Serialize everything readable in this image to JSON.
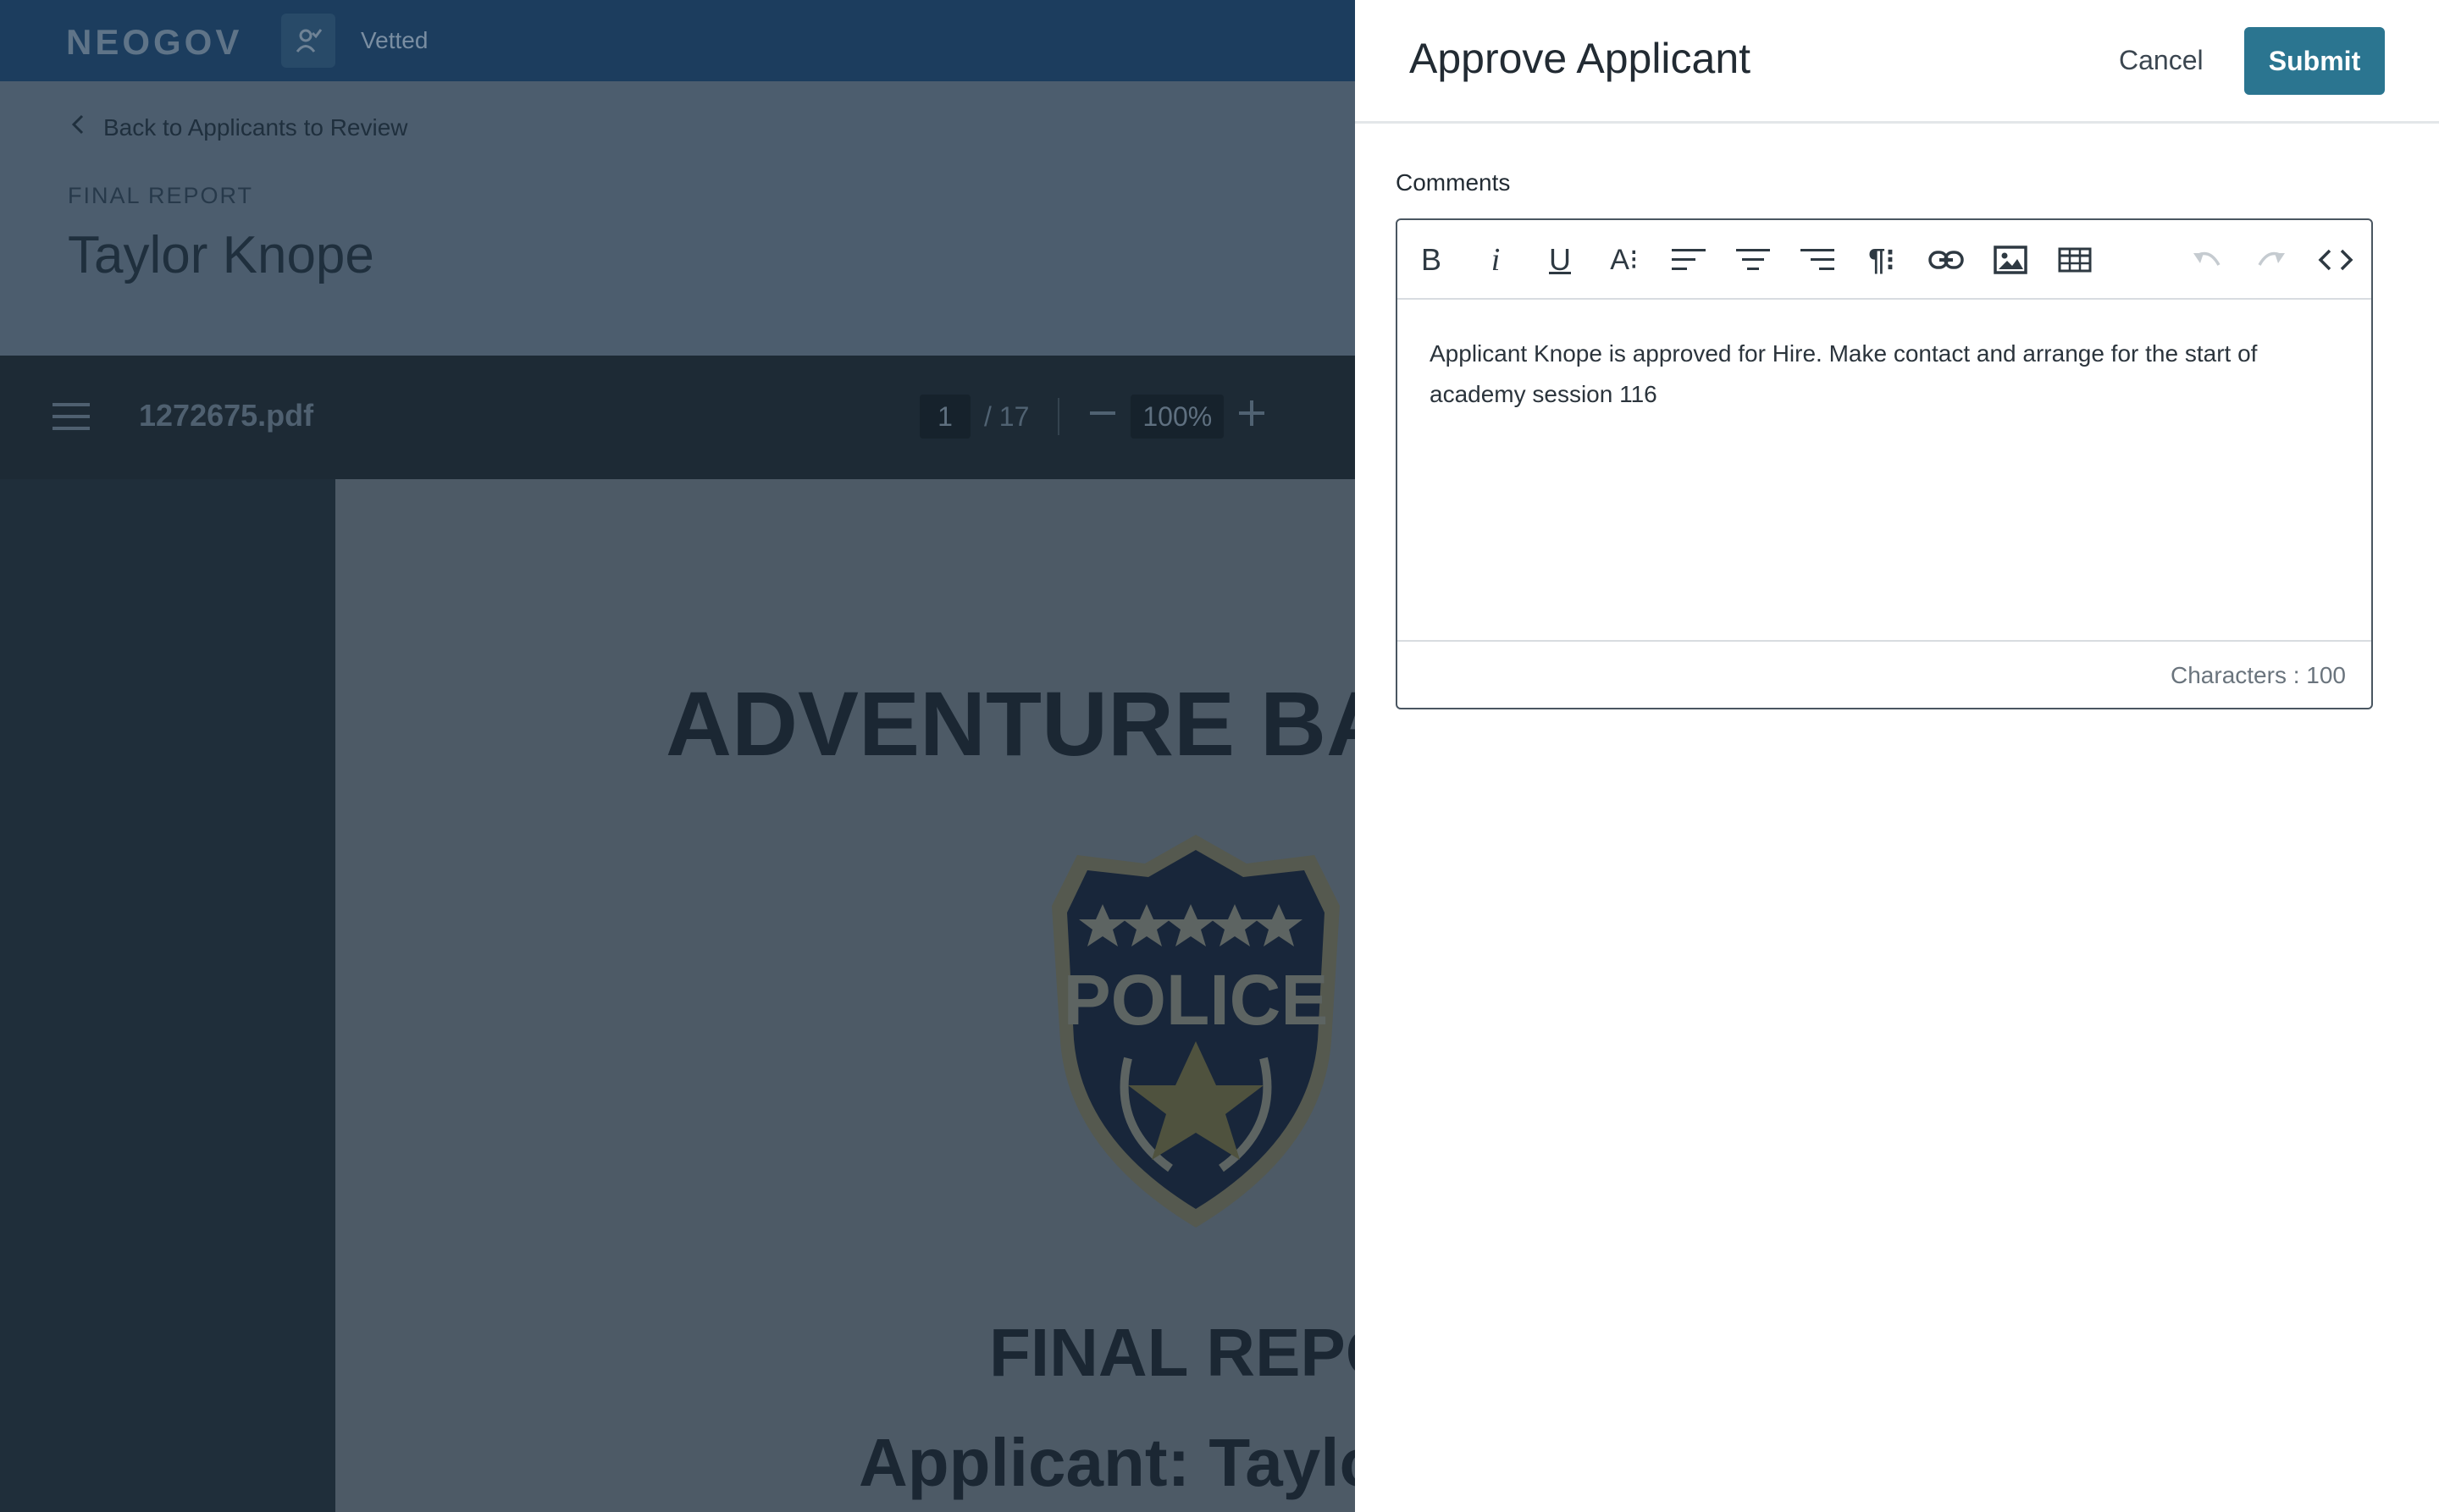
{
  "app": {
    "logo": "NEOGOV",
    "product": "Vetted"
  },
  "header": {
    "back_link": "Back to Applicants to Review",
    "eyebrow": "FINAL REPORT",
    "title": "Taylor Knope"
  },
  "pdf_viewer": {
    "file_name": "1272675.pdf",
    "current_page": "1",
    "total_pages": "/ 17",
    "zoom": "100%",
    "document": {
      "heading": "ADVENTURE BA",
      "badge_text": "POLICE",
      "final_heading": "FINAL REPO",
      "applicant_line": "Applicant: Taylor"
    }
  },
  "drawer": {
    "title": "Approve Applicant",
    "cancel_label": "Cancel",
    "submit_label": "Submit",
    "comments_label": "Comments",
    "comment_text": "Applicant Knope is approved for Hire. Make contact and arrange for the start of academy session 116",
    "char_count": "Characters : 100",
    "toolbar_icons": [
      "bold-icon",
      "italic-icon",
      "underline-icon",
      "font-size-icon",
      "align-left-icon",
      "align-center-icon",
      "align-right-icon",
      "paragraph-format-icon",
      "link-icon",
      "image-icon",
      "table-icon",
      "undo-icon",
      "redo-icon",
      "code-view-icon"
    ],
    "toolbar_glyphs": {
      "bold": "B",
      "italic": "i",
      "underline": "U",
      "font_size": "A⁝",
      "paragraph": "¶⁝"
    }
  },
  "colors": {
    "primary": "#2b7590",
    "topbar": "#1c3d5e",
    "overlay_dim": "#1f2e3a"
  }
}
